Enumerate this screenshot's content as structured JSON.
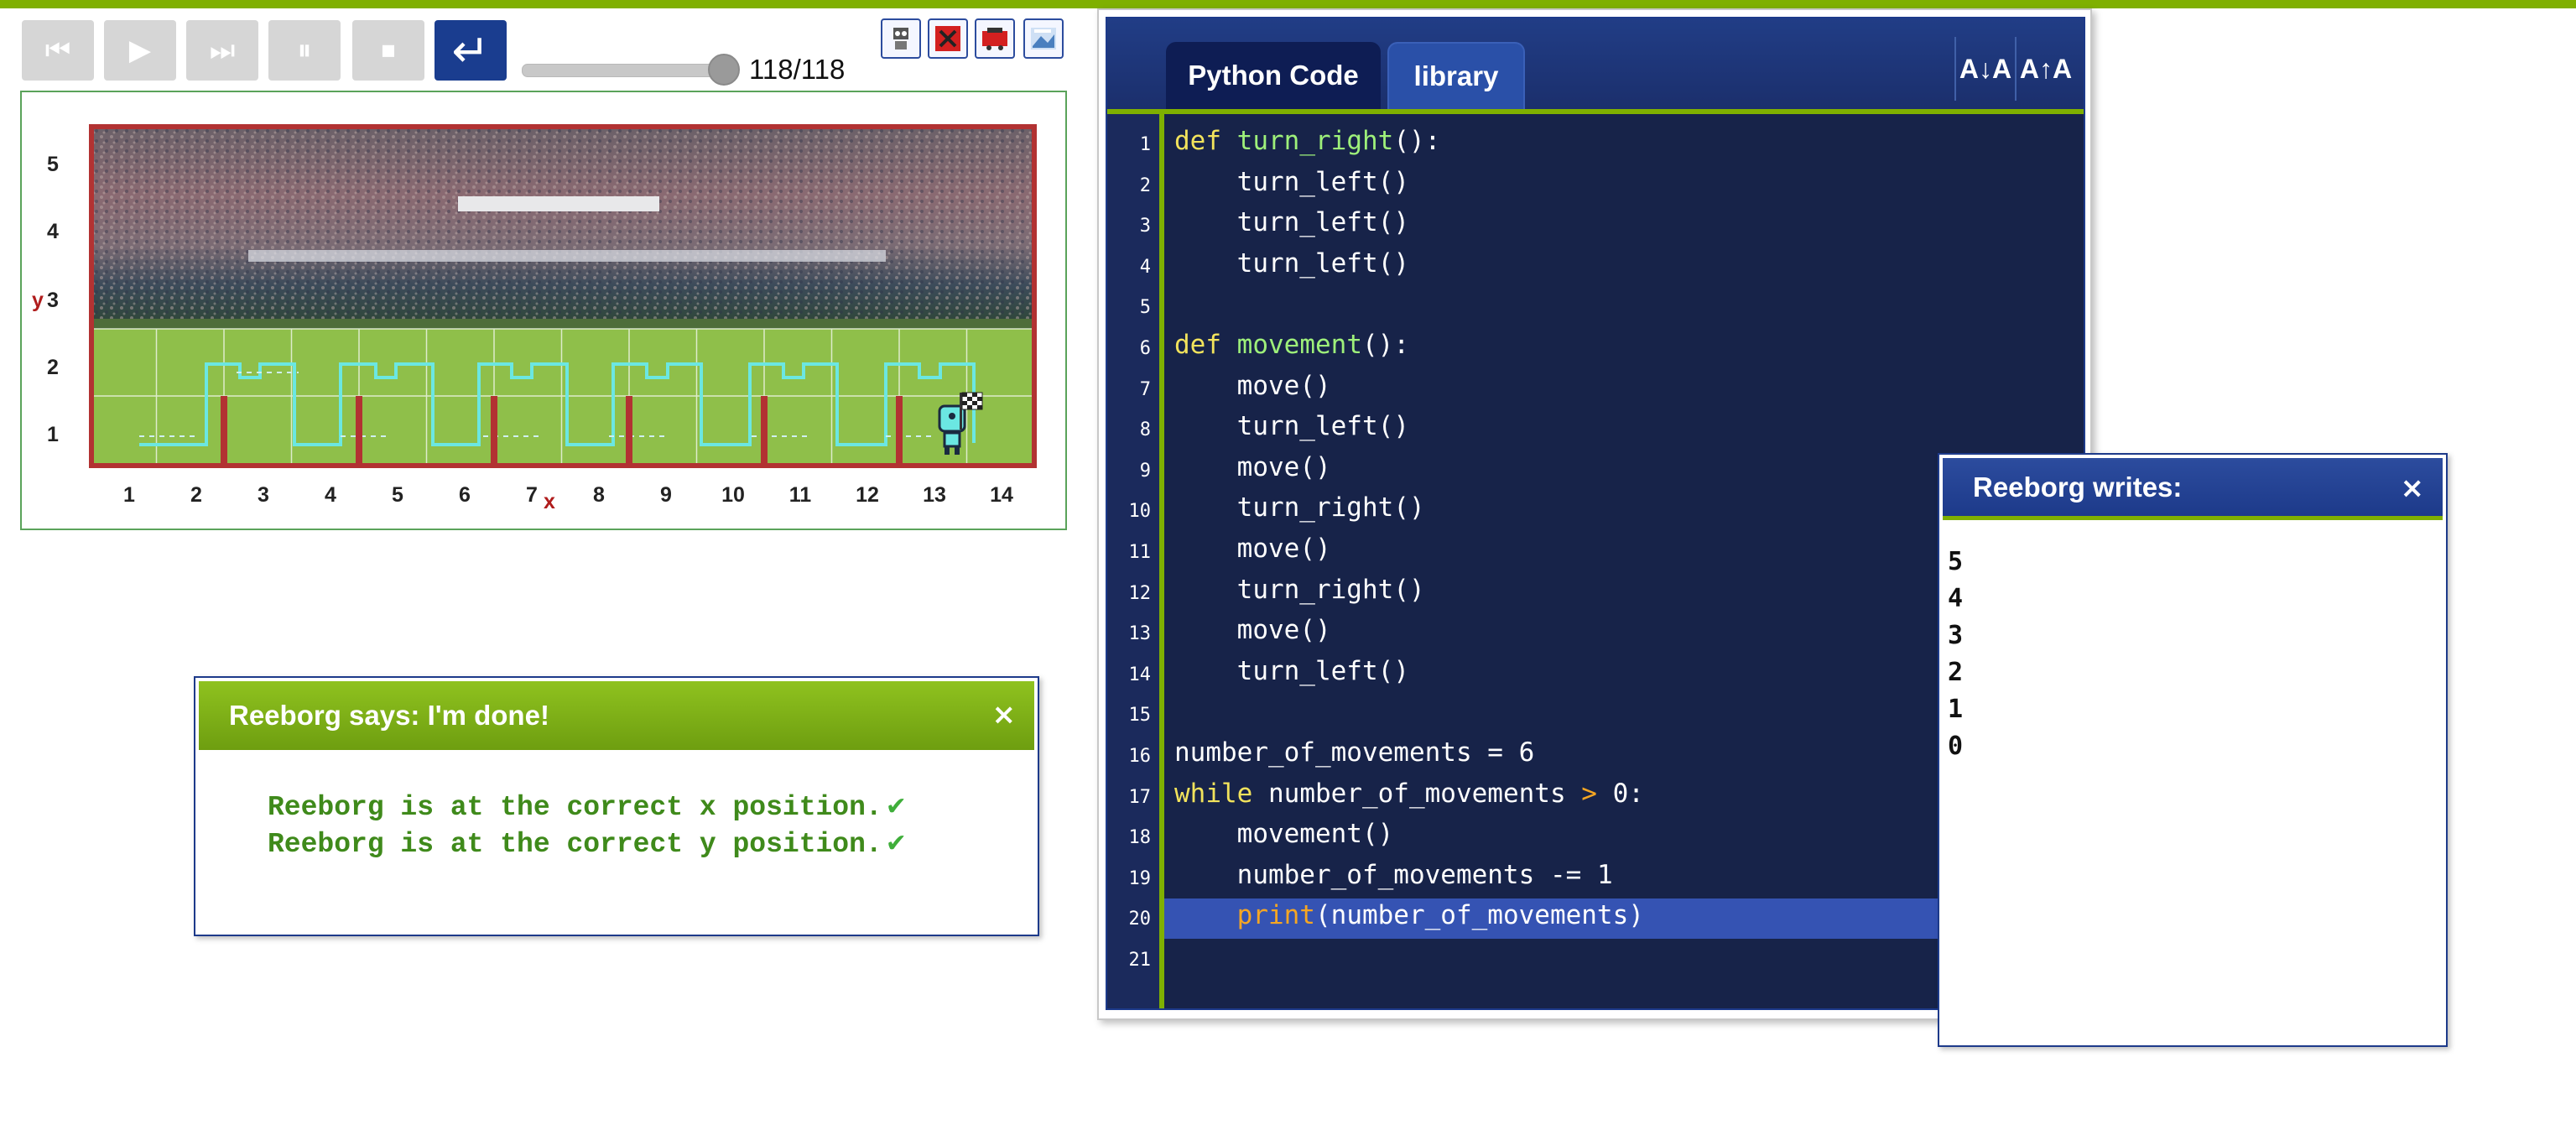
{
  "toolbar": {
    "buttons": [
      {
        "name": "reverse-step-button",
        "icon": "skip-back-icon",
        "glyph": "⏮",
        "active": false
      },
      {
        "name": "run-button",
        "icon": "play-icon",
        "glyph": "▶",
        "active": false
      },
      {
        "name": "step-button",
        "icon": "skip-forward-icon",
        "glyph": "⏭",
        "active": false
      },
      {
        "name": "pause-button",
        "icon": "pause-icon",
        "glyph": "⏸",
        "active": false
      },
      {
        "name": "stop-button",
        "icon": "stop-icon",
        "glyph": "⏹",
        "active": false
      },
      {
        "name": "reload-button",
        "icon": "return-icon",
        "glyph": "↵",
        "active": true
      }
    ],
    "step_counter": "118/118",
    "step_fraction": 1.0,
    "view_icons": [
      "robot-view-icon",
      "world-edit-icon",
      "robot-alt-icon",
      "world-image-icon"
    ]
  },
  "world": {
    "y_axis_letter": "y",
    "x_axis_letter": "x",
    "y_labels": [
      "5",
      "4",
      "3",
      "2",
      "1"
    ],
    "x_labels": [
      "1",
      "2",
      "3",
      "4",
      "5",
      "6",
      "7",
      "8",
      "9",
      "10",
      "11",
      "12",
      "13",
      "14"
    ],
    "colors": {
      "wall": "#b23232",
      "path": "#6be7e2",
      "field": "#8fbf4a",
      "crowd": "#5e4f55"
    }
  },
  "done_dialog": {
    "title": "Reeborg says: I'm done!",
    "close": "×",
    "lines": [
      "Reeborg is at the correct x position.",
      "Reeborg is at the correct y position."
    ],
    "check_glyph": "✔"
  },
  "editor": {
    "tabs": [
      "Python Code",
      "library"
    ],
    "active_tab": "Python Code",
    "font_decrease": "A↓A",
    "font_increase": "A↑A",
    "highlighted_line": 20,
    "line_numbers": [
      "1",
      "2",
      "3",
      "4",
      "5",
      "6",
      "7",
      "8",
      "9",
      "10",
      "11",
      "12",
      "13",
      "14",
      "15",
      "16",
      "17",
      "18",
      "19",
      "20",
      "21"
    ],
    "code": [
      "def turn_right():",
      "    turn_left()",
      "    turn_left()",
      "    turn_left()",
      "",
      "def movement():",
      "    move()",
      "    turn_left()",
      "    move()",
      "    turn_right()",
      "    move()",
      "    turn_right()",
      "    move()",
      "    turn_left()",
      "",
      "number_of_movements = 6",
      "while number_of_movements > 0:",
      "    movement()",
      "    number_of_movements -= 1",
      "    print(number_of_movements)",
      ""
    ]
  },
  "writes_dialog": {
    "title": "Reeborg writes:",
    "close": "×",
    "output": [
      "5",
      "4",
      "3",
      "2",
      "1",
      "0"
    ]
  }
}
